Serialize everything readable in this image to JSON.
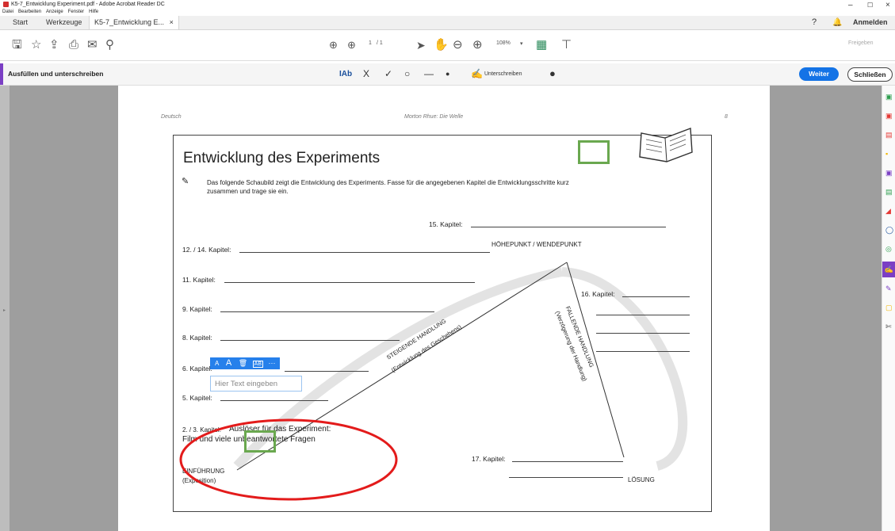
{
  "window": {
    "title": "K5-7_Entwicklung Experiment.pdf - Adobe Acrobat Reader DC",
    "menu": [
      "Datei",
      "Bearbeiten",
      "Anzeige",
      "Fenster",
      "Hilfe"
    ],
    "controls": [
      "–",
      "☐",
      "×"
    ]
  },
  "tabs": {
    "start": "Start",
    "tools": "Werkzeuge",
    "doc": "K5-7_Entwicklung E...",
    "doc_close": "×",
    "signin": "Anmelden",
    "share": "Freigeben"
  },
  "toolbar": {
    "page_current": "1",
    "page_total": "/ 1",
    "zoom": "108%"
  },
  "fill_sign": {
    "title": "Ausfüllen und unterschreiben",
    "text_tool": "IAb",
    "sign_label": "Unterschreiben",
    "continue": "Weiter",
    "close": "Schließen"
  },
  "page": {
    "header_left": "Deutsch",
    "header_center": "Morton Rhue: Die Welle",
    "header_right": "8",
    "heading": "Entwicklung des Experiments",
    "instruction_line1": "Das folgende Schaubild zeigt die Entwicklung des Experiments. Fasse für die angegebenen Kapitel die Entwicklungsschritte kurz",
    "instruction_line2": "zusammen und trage sie ein.",
    "ch15": "15. Kapitel:",
    "climax": "HÖHEPUNKT / WENDEPUNKT",
    "ch12": "12. / 14. Kapitel:",
    "ch11": "11. Kapitel:",
    "ch9": "9. Kapitel:",
    "ch16": "16. Kapitel:",
    "ch8": "8. Kapitel:",
    "ch6": "6. Kapitel:",
    "ch5": "5. Kapitel:",
    "ch23_label": "2. / 3. Kapitel:",
    "ch23_entry1": "Auslöser für das Experiment:",
    "ch23_entry2": "Film und viele unbeantwortete Fragen",
    "rising1": "STEIGENDE HANDLUNG",
    "rising2": "(Entwicklung des Geschehens)",
    "falling1": "FALLENDE HANDLUNG",
    "falling2": "(Verzögerung der Handlung)",
    "ch17": "17. Kapitel:",
    "intro1": "EINFÜHRUNG",
    "intro2": "(Exposition)",
    "resolution": "LÖSUNG"
  },
  "comment": {
    "placeholder": "Hier Text eingeben",
    "tools": [
      "A",
      "A",
      "🗑",
      "AB",
      "···"
    ]
  }
}
